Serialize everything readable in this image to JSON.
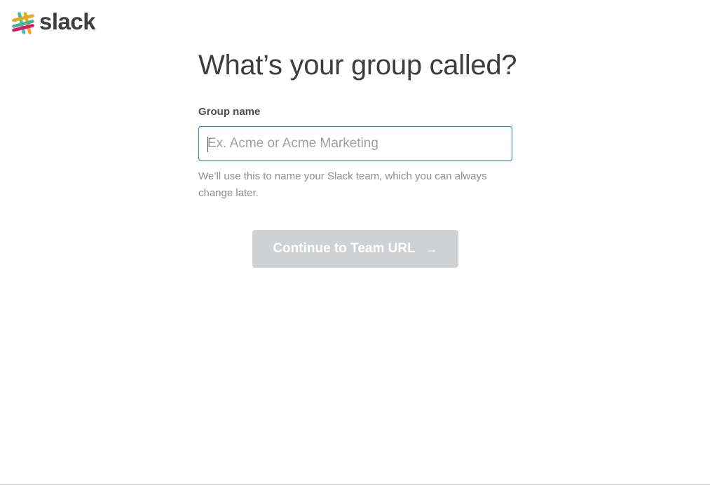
{
  "brand": {
    "name": "slack",
    "colors": {
      "teal": "#36c5ab",
      "yellow": "#e9a820",
      "pink": "#e01563",
      "green": "#3eb991",
      "blue": "#2a80b9"
    }
  },
  "page": {
    "title": "What’s your group called?"
  },
  "form": {
    "group_name_label": "Group name",
    "group_name_value": "",
    "group_name_placeholder": "Ex. Acme or Acme Marketing",
    "hint": "We’ll use this to name your Slack team, which you can always change later."
  },
  "actions": {
    "continue_label": "Continue to Team URL",
    "continue_icon": "arrow-right-icon",
    "continue_disabled": true
  }
}
